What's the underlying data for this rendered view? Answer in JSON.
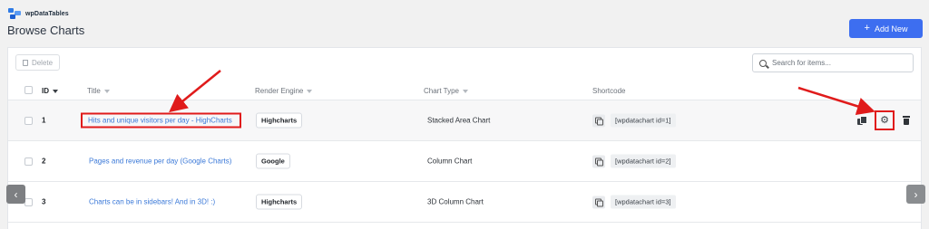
{
  "brand": {
    "name": "wpDataTables"
  },
  "page": {
    "title": "Browse Charts"
  },
  "toolbar": {
    "add_label": "Add New",
    "delete_label": "Delete"
  },
  "search": {
    "placeholder": "Search for items..."
  },
  "table": {
    "headers": {
      "id": "ID",
      "title": "Title",
      "engine": "Render Engine",
      "type": "Chart Type",
      "shortcode": "Shortcode"
    },
    "rows": [
      {
        "id": "1",
        "title": "Hits and unique visitors per day - HighCharts",
        "engine": "Highcharts",
        "type": "Stacked Area Chart",
        "shortcode": "[wpdatachart id=1]"
      },
      {
        "id": "2",
        "title": "Pages and revenue per day (Google Charts)",
        "engine": "Google",
        "type": "Column Chart",
        "shortcode": "[wpdatachart id=2]"
      },
      {
        "id": "3",
        "title": "Charts can be in sidebars! And in 3D! :)",
        "engine": "Highcharts",
        "type": "3D Column Chart",
        "shortcode": "[wpdatachart id=3]"
      }
    ]
  },
  "icons": {
    "add": "plus-icon",
    "delete": "trash-icon",
    "search": "search-icon",
    "copy": "copy-icon",
    "duplicate": "duplicate-icon",
    "settings": "gear-icon",
    "prev": "chevron-left-icon",
    "next": "chevron-right-icon"
  },
  "colors": {
    "accent": "#3d6ef0",
    "link": "#3b79d8",
    "annotation": "#e01b1b"
  }
}
